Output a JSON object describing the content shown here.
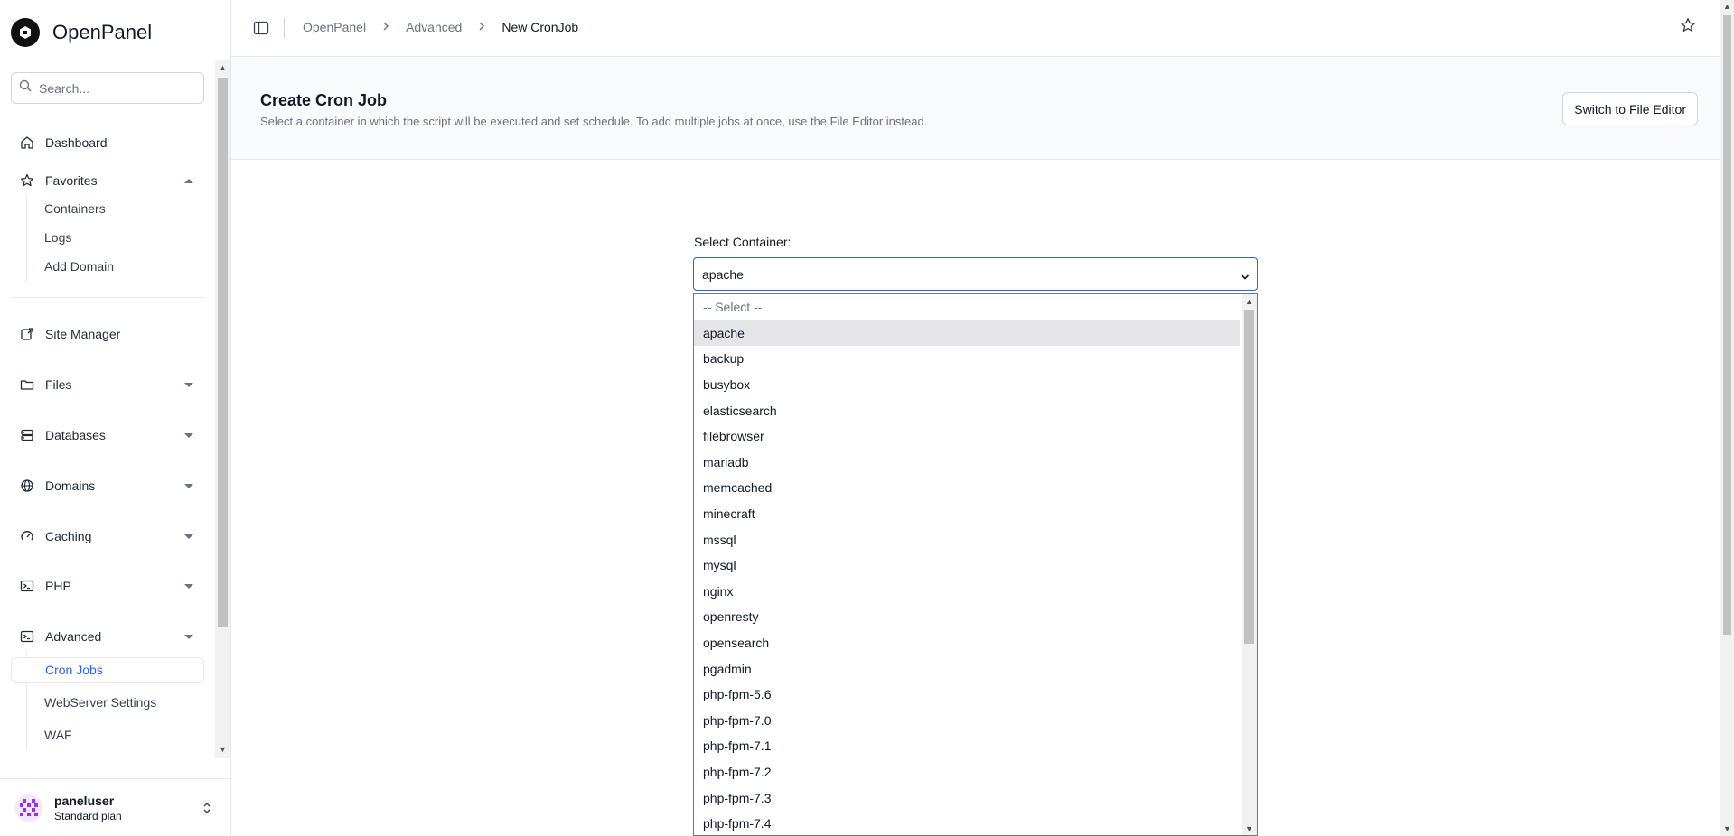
{
  "brand": {
    "name": "OpenPanel"
  },
  "search": {
    "placeholder": "Search..."
  },
  "nav": {
    "dashboard": "Dashboard",
    "favorites": "Favorites",
    "favorites_items": [
      "Containers",
      "Logs",
      "Add Domain"
    ],
    "site_manager": "Site Manager",
    "files": "Files",
    "databases": "Databases",
    "domains": "Domains",
    "caching": "Caching",
    "php": "PHP",
    "advanced": "Advanced",
    "advanced_items": [
      "Cron Jobs",
      "WebServer Settings",
      "WAF"
    ],
    "active_item": "Cron Jobs"
  },
  "user": {
    "name": "paneluser",
    "plan": "Standard plan"
  },
  "breadcrumb": {
    "items": [
      "OpenPanel",
      "Advanced",
      "New CronJob"
    ]
  },
  "header": {
    "title": "Create Cron Job",
    "description": "Select a container in which the script will be executed and set schedule. To add multiple jobs at once, use the File Editor instead.",
    "switch_button": "Switch to File Editor"
  },
  "form": {
    "container_label": "Select Container:",
    "container_value": "apache",
    "options": [
      "-- Select --",
      "apache",
      "backup",
      "busybox",
      "elasticsearch",
      "filebrowser",
      "mariadb",
      "memcached",
      "minecraft",
      "mssql",
      "mysql",
      "nginx",
      "openresty",
      "opensearch",
      "pgadmin",
      "php-fpm-5.6",
      "php-fpm-7.0",
      "php-fpm-7.1",
      "php-fpm-7.2",
      "php-fpm-7.3",
      "php-fpm-7.4"
    ],
    "selected_option": "apache"
  },
  "colors": {
    "accent": "#2563eb",
    "selected_bg": "#e5e5e7",
    "border": "#e5e7eb"
  }
}
